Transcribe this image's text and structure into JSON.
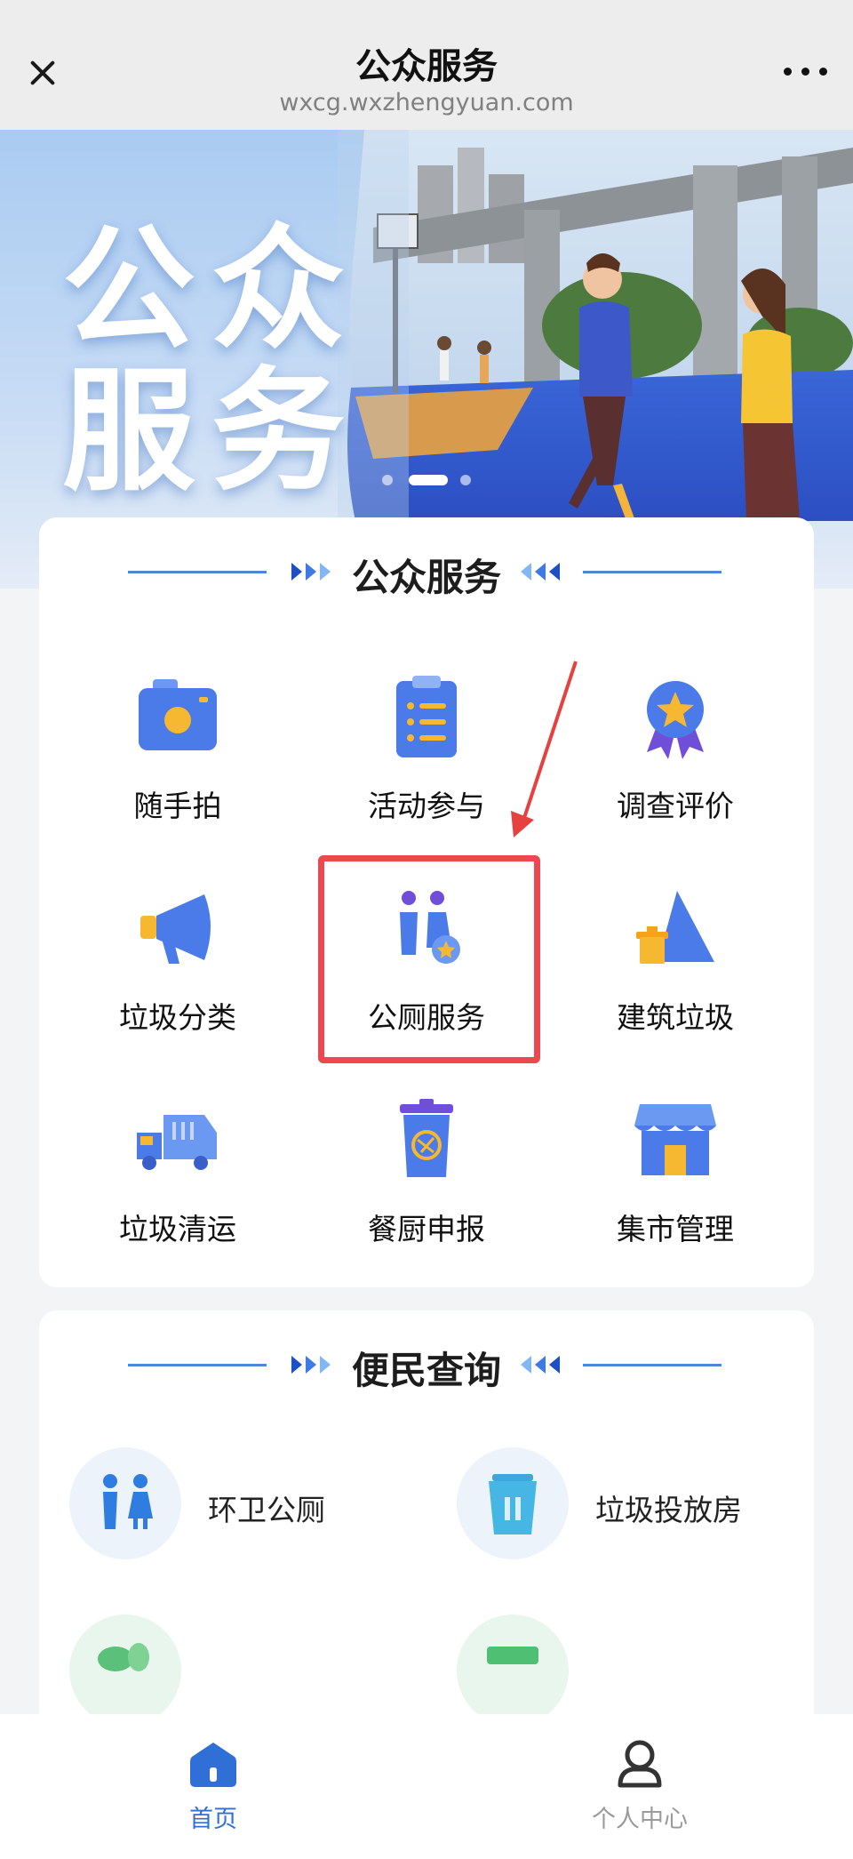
{
  "header": {
    "title": "公众服务",
    "url": "wxcg.wxzhengyuan.com"
  },
  "banner": {
    "line1": "公众",
    "line2": "服务"
  },
  "public_services": {
    "title": "公众服务",
    "items": [
      {
        "label": "随手拍",
        "icon": "camera-icon"
      },
      {
        "label": "活动参与",
        "icon": "clipboard-icon"
      },
      {
        "label": "调查评价",
        "icon": "award-medal-icon"
      },
      {
        "label": "垃圾分类",
        "icon": "megaphone-icon"
      },
      {
        "label": "公厕服务",
        "icon": "toilet-people-icon"
      },
      {
        "label": "建筑垃圾",
        "icon": "construction-waste-icon"
      },
      {
        "label": "垃圾清运",
        "icon": "garbage-truck-icon"
      },
      {
        "label": "餐厨申报",
        "icon": "kitchen-bin-icon"
      },
      {
        "label": "集市管理",
        "icon": "market-stall-icon"
      }
    ]
  },
  "convenience_query": {
    "title": "便民查询",
    "items": [
      {
        "label": "环卫公厕",
        "icon": "restroom-icon"
      },
      {
        "label": "垃圾投放房",
        "icon": "trash-room-icon"
      },
      {
        "label": "",
        "icon": "vegetable-icon"
      },
      {
        "label": "",
        "icon": "box-icon"
      }
    ]
  },
  "tabbar": {
    "home": "首页",
    "profile": "个人中心"
  },
  "colors": {
    "accent": "#4a7be8",
    "highlight": "#ea4a4f",
    "tab_active": "#2f6fd6",
    "tab_inactive": "#9a9a9a"
  }
}
